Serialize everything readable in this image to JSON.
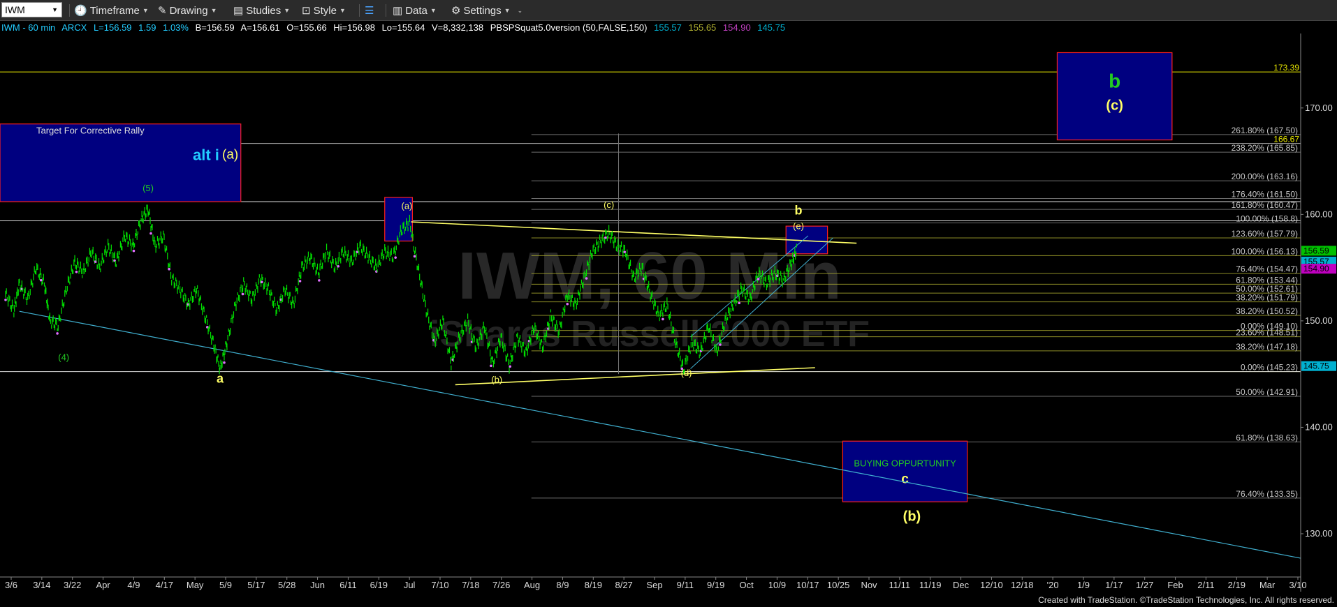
{
  "toolbar": {
    "symbol": "IWM",
    "timeframe": "Timeframe",
    "drawing": "Drawing",
    "studies": "Studies",
    "style": "Style",
    "data": "Data",
    "settings": "Settings"
  },
  "info": {
    "instrument": "IWM - 60 min",
    "exchange": "ARCX",
    "last": "L=156.59",
    "change": "1.59",
    "change_pct": "1.03%",
    "bid": "B=156.59",
    "ask": "A=156.61",
    "open": "O=155.66",
    "high": "Hi=156.98",
    "low": "Lo=155.64",
    "volume": "V=8,332,138",
    "study": "PBSPSquat5.0version (50,FALSE,150)",
    "study_v1": "155.57",
    "study_v2": "155.65",
    "study_v3": "154.90",
    "study_v4": "145.75"
  },
  "colors": {
    "up_bar": "#00e000",
    "dot": "#e070ff",
    "box_fill": "#000080",
    "box_border": "#ff2020",
    "wave_yellow": "#ffff66",
    "wave_green": "#22cc22",
    "wave_cyan": "#22ccff",
    "trend_cyan": "#40b0d0",
    "fib_line": "#b0b030",
    "text_label": "#c8c8c8"
  },
  "watermark": {
    "line1": "IWM, 60 Min",
    "line2": "iShares Russell 2000 ETF"
  },
  "footer": "Created with TradeStation. ©TradeStation Technologies, Inc. All rights reserved.",
  "chart_data": {
    "type": "line",
    "ylim": [
      126,
      177
    ],
    "y_ticks": [
      130,
      140,
      150,
      160,
      170
    ],
    "x_labels": [
      "3/6",
      "3/14",
      "3/22",
      "Apr",
      "4/9",
      "4/17",
      "May",
      "5/9",
      "5/17",
      "5/28",
      "Jun",
      "6/11",
      "6/19",
      "Jul",
      "7/10",
      "7/18",
      "7/26",
      "Aug",
      "8/9",
      "8/19",
      "8/27",
      "Sep",
      "9/11",
      "9/19",
      "Oct",
      "10/9",
      "10/17",
      "10/25",
      "Nov",
      "11/11",
      "11/19",
      "Dec",
      "12/10",
      "12/18",
      "'20",
      "1/9",
      "1/17",
      "1/27",
      "Feb",
      "2/11",
      "2/19",
      "Mar",
      "3/10"
    ],
    "price_series": [
      {
        "t": 0,
        "v": 152.5
      },
      {
        "t": 0.6,
        "v": 151.0
      },
      {
        "t": 1,
        "v": 153.5
      },
      {
        "t": 1.6,
        "v": 152.0
      },
      {
        "t": 2.2,
        "v": 155.0
      },
      {
        "t": 2.8,
        "v": 153.5
      },
      {
        "t": 3.2,
        "v": 150.0
      },
      {
        "t": 3.8,
        "v": 149.5
      },
      {
        "t": 4.4,
        "v": 153.0
      },
      {
        "t": 5,
        "v": 155.5
      },
      {
        "t": 5.6,
        "v": 154.5
      },
      {
        "t": 6.2,
        "v": 156.5
      },
      {
        "t": 6.8,
        "v": 155.0
      },
      {
        "t": 7.4,
        "v": 157.0
      },
      {
        "t": 8,
        "v": 155.5
      },
      {
        "t": 8.6,
        "v": 158.0
      },
      {
        "t": 9.2,
        "v": 157.0
      },
      {
        "t": 9.8,
        "v": 159.5
      },
      {
        "t": 10.3,
        "v": 160.5
      },
      {
        "t": 10.8,
        "v": 157.0
      },
      {
        "t": 11.4,
        "v": 158.0
      },
      {
        "t": 12,
        "v": 154.0
      },
      {
        "t": 12.6,
        "v": 153.0
      },
      {
        "t": 13.2,
        "v": 151.5
      },
      {
        "t": 13.8,
        "v": 153.0
      },
      {
        "t": 14.4,
        "v": 150.5
      },
      {
        "t": 15,
        "v": 148.0
      },
      {
        "t": 15.5,
        "v": 145.5
      },
      {
        "t": 16,
        "v": 148.0
      },
      {
        "t": 16.6,
        "v": 151.5
      },
      {
        "t": 17.2,
        "v": 153.5
      },
      {
        "t": 17.8,
        "v": 152.0
      },
      {
        "t": 18.4,
        "v": 154.0
      },
      {
        "t": 19,
        "v": 153.0
      },
      {
        "t": 19.6,
        "v": 151.0
      },
      {
        "t": 20.2,
        "v": 153.0
      },
      {
        "t": 20.8,
        "v": 151.5
      },
      {
        "t": 21.4,
        "v": 155.0
      },
      {
        "t": 22,
        "v": 156.0
      },
      {
        "t": 22.6,
        "v": 154.5
      },
      {
        "t": 23.2,
        "v": 156.5
      },
      {
        "t": 23.8,
        "v": 155.0
      },
      {
        "t": 24.4,
        "v": 156.5
      },
      {
        "t": 25,
        "v": 155.5
      },
      {
        "t": 25.6,
        "v": 157.0
      },
      {
        "t": 26.2,
        "v": 156.0
      },
      {
        "t": 26.8,
        "v": 155.0
      },
      {
        "t": 27.4,
        "v": 156.5
      },
      {
        "t": 28,
        "v": 156.0
      },
      {
        "t": 28.6,
        "v": 158.5
      },
      {
        "t": 29.2,
        "v": 159.2
      },
      {
        "t": 29.8,
        "v": 155.0
      },
      {
        "t": 30.4,
        "v": 151.0
      },
      {
        "t": 31,
        "v": 148.0
      },
      {
        "t": 31.6,
        "v": 150.0
      },
      {
        "t": 32.2,
        "v": 146.0
      },
      {
        "t": 32.8,
        "v": 148.5
      },
      {
        "t": 33.4,
        "v": 150.0
      },
      {
        "t": 34,
        "v": 147.5
      },
      {
        "t": 34.6,
        "v": 149.5
      },
      {
        "t": 35.2,
        "v": 146.0
      },
      {
        "t": 35.8,
        "v": 148.5
      },
      {
        "t": 36.4,
        "v": 145.8
      },
      {
        "t": 37,
        "v": 148.5
      },
      {
        "t": 37.6,
        "v": 147.0
      },
      {
        "t": 38.2,
        "v": 149.5
      },
      {
        "t": 38.8,
        "v": 147.5
      },
      {
        "t": 39.4,
        "v": 150.5
      },
      {
        "t": 40,
        "v": 149.0
      },
      {
        "t": 40.6,
        "v": 152.5
      },
      {
        "t": 41.2,
        "v": 151.5
      },
      {
        "t": 41.8,
        "v": 154.0
      },
      {
        "t": 42.4,
        "v": 156.5
      },
      {
        "t": 43,
        "v": 157.5
      },
      {
        "t": 43.6,
        "v": 158.3
      },
      {
        "t": 44.2,
        "v": 157.0
      },
      {
        "t": 44.8,
        "v": 156.5
      },
      {
        "t": 45.4,
        "v": 154.0
      },
      {
        "t": 46,
        "v": 155.0
      },
      {
        "t": 46.6,
        "v": 152.5
      },
      {
        "t": 47.2,
        "v": 150.5
      },
      {
        "t": 47.8,
        "v": 151.5
      },
      {
        "t": 48.4,
        "v": 148.0
      },
      {
        "t": 49,
        "v": 145.4
      },
      {
        "t": 49.6,
        "v": 148.0
      },
      {
        "t": 50.2,
        "v": 147.0
      },
      {
        "t": 50.8,
        "v": 149.5
      },
      {
        "t": 51.4,
        "v": 147.0
      },
      {
        "t": 52,
        "v": 150.0
      },
      {
        "t": 52.6,
        "v": 151.5
      },
      {
        "t": 53.2,
        "v": 153.0
      },
      {
        "t": 53.8,
        "v": 152.0
      },
      {
        "t": 54.4,
        "v": 154.5
      },
      {
        "t": 55,
        "v": 153.5
      },
      {
        "t": 55.6,
        "v": 154.5
      },
      {
        "t": 56.2,
        "v": 153.8
      },
      {
        "t": 56.8,
        "v": 155.5
      },
      {
        "t": 57.2,
        "v": 156.8
      }
    ],
    "wave_labels": [
      {
        "text": "(4)",
        "t": 4.2,
        "v": 146.3,
        "color": "green"
      },
      {
        "text": "(5)",
        "t": 10.3,
        "v": 162.2,
        "color": "green"
      },
      {
        "text": "a",
        "t": 15.5,
        "v": 144.2,
        "color": "yellow"
      },
      {
        "text": "(a)",
        "t": 29.0,
        "v": 160.5,
        "color": "yellow"
      },
      {
        "text": "(b)",
        "t": 35.5,
        "v": 144.2,
        "color": "yellow"
      },
      {
        "text": "(c)",
        "t": 43.6,
        "v": 160.6,
        "color": "yellow"
      },
      {
        "text": "(d)",
        "t": 49.2,
        "v": 144.8,
        "color": "yellow"
      },
      {
        "text": "(e)",
        "t": 57.3,
        "v": 158.6,
        "color": "yellow"
      },
      {
        "text": "b",
        "t": 57.3,
        "v": 160.0,
        "color": "yellow"
      }
    ],
    "fib_levels": [
      {
        "label": "261.80% (167.50)",
        "v": 167.5
      },
      {
        "label": "238.20% (165.85)",
        "v": 165.85
      },
      {
        "label": "200.00% (163.16)",
        "v": 163.16
      },
      {
        "label": "176.40% (161.50)",
        "v": 161.5
      },
      {
        "label": "161.80% (160.47)",
        "v": 160.47
      },
      {
        "label": "100.00% (158.8)",
        "v": 159.2
      },
      {
        "label": "123.60% (157.79)",
        "v": 157.79
      },
      {
        "label": "100.00% (156.13)",
        "v": 156.13
      },
      {
        "label": "76.40% (154.47)",
        "v": 154.47
      },
      {
        "label": "61.80% (153.44)",
        "v": 153.44
      },
      {
        "label": "50.00% (152.61)",
        "v": 152.61
      },
      {
        "label": "38.20% (151.79)",
        "v": 151.79
      },
      {
        "label": "38.20% (150.52)",
        "v": 150.52
      },
      {
        "label": "0.00% (149.10)",
        "v": 149.1
      },
      {
        "label": "23.60% (148.51)",
        "v": 148.51
      },
      {
        "label": "38.20% (147.18)",
        "v": 147.18
      },
      {
        "label": "0.00% (145.23)",
        "v": 145.23
      },
      {
        "label": "50.00% (142.91)",
        "v": 142.91
      },
      {
        "label": "61.80% (138.63)",
        "v": 138.63
      },
      {
        "label": "76.40% (133.35)",
        "v": 133.35
      }
    ],
    "horizontal_lines": [
      {
        "label": "173.39",
        "v": 173.39
      },
      {
        "label": "166.67",
        "v": 166.67
      }
    ],
    "axis_markers": [
      {
        "label": "156.59",
        "v": 156.59,
        "color": "#00c000"
      },
      {
        "label": "155.57",
        "v": 155.57,
        "color": "#00b0d0"
      },
      {
        "label": "154.90",
        "v": 154.9,
        "color": "#c000c0"
      },
      {
        "label": "145.75",
        "v": 145.75,
        "color": "#00b0d0"
      }
    ],
    "boxes": [
      {
        "name": "target-box",
        "label": "Target For Corrective Rally",
        "sub1": "alt i",
        "sub2": "(a)",
        "t0": -1,
        "t1": 17.0,
        "v0": 161.2,
        "v1": 168.5
      },
      {
        "name": "wave-a-box",
        "t0": 27.4,
        "t1": 29.4,
        "v0": 157.5,
        "v1": 161.6
      },
      {
        "name": "wave-e-box",
        "t0": 56.4,
        "t1": 59.4,
        "v0": 156.3,
        "v1": 158.9
      },
      {
        "name": "wave-b-box",
        "label": "b",
        "sub2": "(c)",
        "t0": 76,
        "t1": 84.3,
        "v0": 167.0,
        "v1": 175.2
      },
      {
        "name": "buying-box",
        "label": "BUYING OPPURTUNITY",
        "sub2": "c",
        "t0": 60.5,
        "t1": 69.5,
        "v0": 133.0,
        "v1": 138.7
      }
    ],
    "extra_labels": [
      {
        "text": "(b)",
        "t": 65.5,
        "v": 131.2,
        "color": "yellow"
      }
    ]
  }
}
